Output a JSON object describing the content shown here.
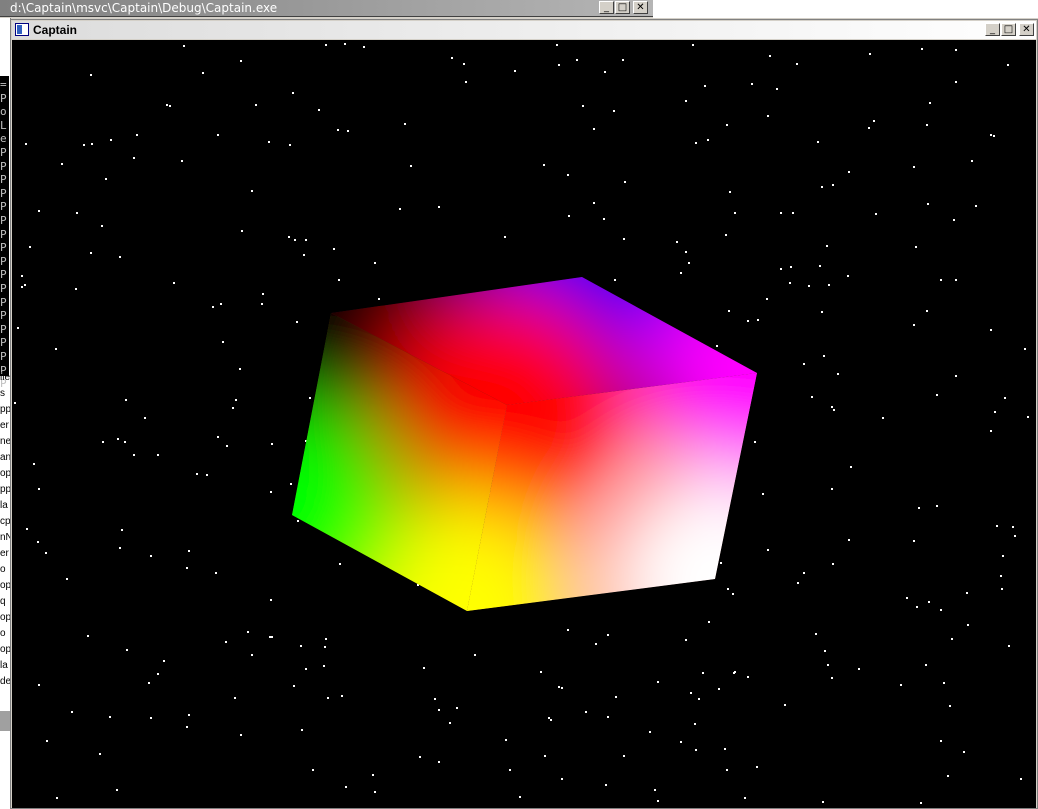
{
  "console_window": {
    "title": "d:\\Captain\\msvc\\Captain\\Debug\\Captain.exe",
    "minimize_glyph": "_",
    "maximize_glyph": "□",
    "close_glyph": "✕"
  },
  "side_panel": {
    "console_chars": [
      "=",
      "P",
      "o",
      "L",
      "e",
      "P",
      "P",
      "P",
      "P",
      "P",
      "P",
      "P",
      "P",
      "P",
      "P",
      "P",
      "P",
      "P",
      "P",
      "P",
      "P",
      "P",
      "P"
    ],
    "words": [
      "ile",
      "s",
      "pp",
      "er",
      "ne",
      "an",
      "op",
      "pp",
      "la",
      "cp",
      "nN",
      "er",
      "o",
      "op",
      "q",
      "op",
      "o",
      "op",
      "la",
      "de"
    ]
  },
  "captain_window": {
    "title": "Captain",
    "minimize_glyph": "_",
    "maximize_glyph": "□",
    "close_glyph": "✕"
  },
  "scene": {
    "background": "#000000",
    "star_color": "#ffffff",
    "cube_corner_colors": {
      "red": "#ff0000",
      "blue": "#0000ff",
      "magenta": "#ff00ff",
      "white": "#ffffff",
      "yellow": "#ffff00",
      "green": "#00ff00",
      "black": "#000000"
    }
  }
}
